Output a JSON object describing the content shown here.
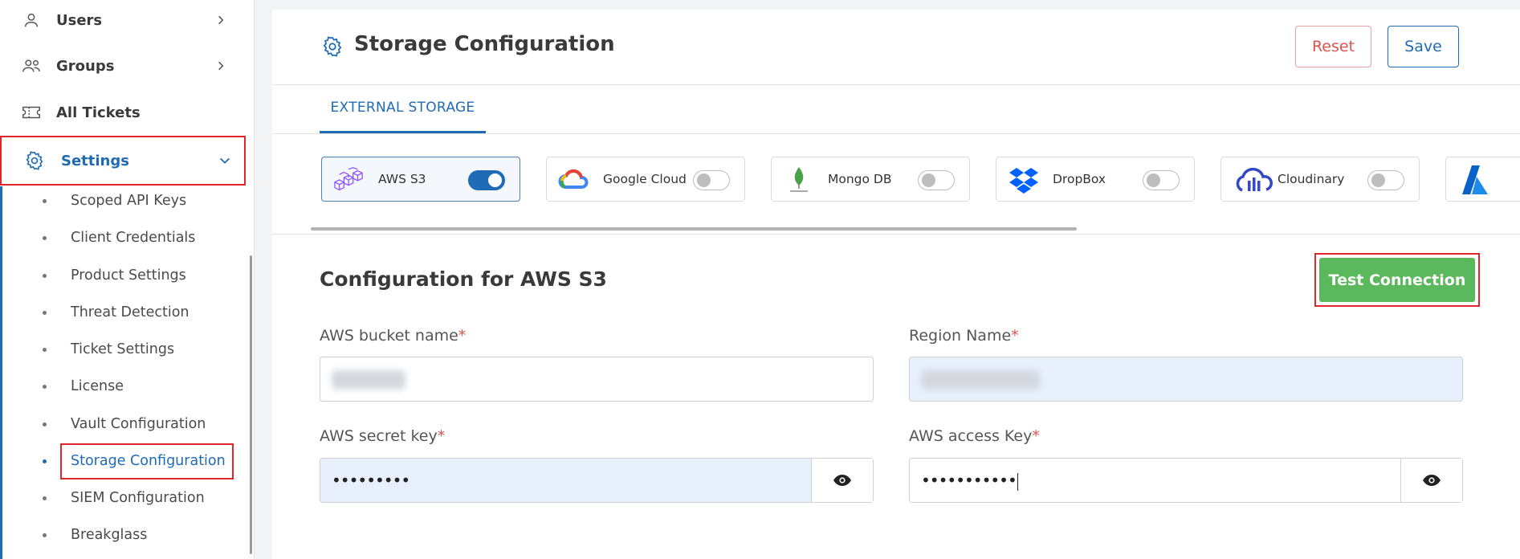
{
  "sidebar": {
    "nav": [
      {
        "label": "Users",
        "icon": "user-icon"
      },
      {
        "label": "Groups",
        "icon": "groups-icon"
      },
      {
        "label": "All Tickets",
        "icon": "ticket-icon"
      },
      {
        "label": "Settings",
        "icon": "gear-icon"
      }
    ],
    "sub_items": [
      "Scoped API Keys",
      "Client Credentials",
      "Product Settings",
      "Threat Detection",
      "Ticket Settings",
      "License",
      "Vault Configuration",
      "Storage Configuration",
      "SIEM Configuration",
      "Breakglass"
    ],
    "active_sub": "Storage Configuration"
  },
  "header": {
    "title": "Storage Configuration",
    "reset_label": "Reset",
    "save_label": "Save"
  },
  "tabs": [
    {
      "label": "EXTERNAL STORAGE"
    }
  ],
  "providers": [
    {
      "label": "AWS S3",
      "enabled": true,
      "icon": "aws-s3-icon"
    },
    {
      "label": "Google Cloud",
      "enabled": false,
      "icon": "google-cloud-icon"
    },
    {
      "label": "Mongo DB",
      "enabled": false,
      "icon": "mongodb-icon"
    },
    {
      "label": "DropBox",
      "enabled": false,
      "icon": "dropbox-icon"
    },
    {
      "label": "Cloudinary",
      "enabled": false,
      "icon": "cloudinary-icon"
    }
  ],
  "config": {
    "title": "Configuration for AWS S3",
    "test_label": "Test Connection",
    "required_mark": "*",
    "fields": {
      "bucket": {
        "label": "AWS bucket name"
      },
      "region": {
        "label": "Region Name"
      },
      "secret": {
        "label": "AWS secret key",
        "value": "•••••••••"
      },
      "access": {
        "label": "AWS access Key",
        "value": "•••••••••••"
      }
    }
  },
  "colors": {
    "accent": "#1f6bb5",
    "highlight": "#e0262d",
    "success": "#5cb85c"
  }
}
